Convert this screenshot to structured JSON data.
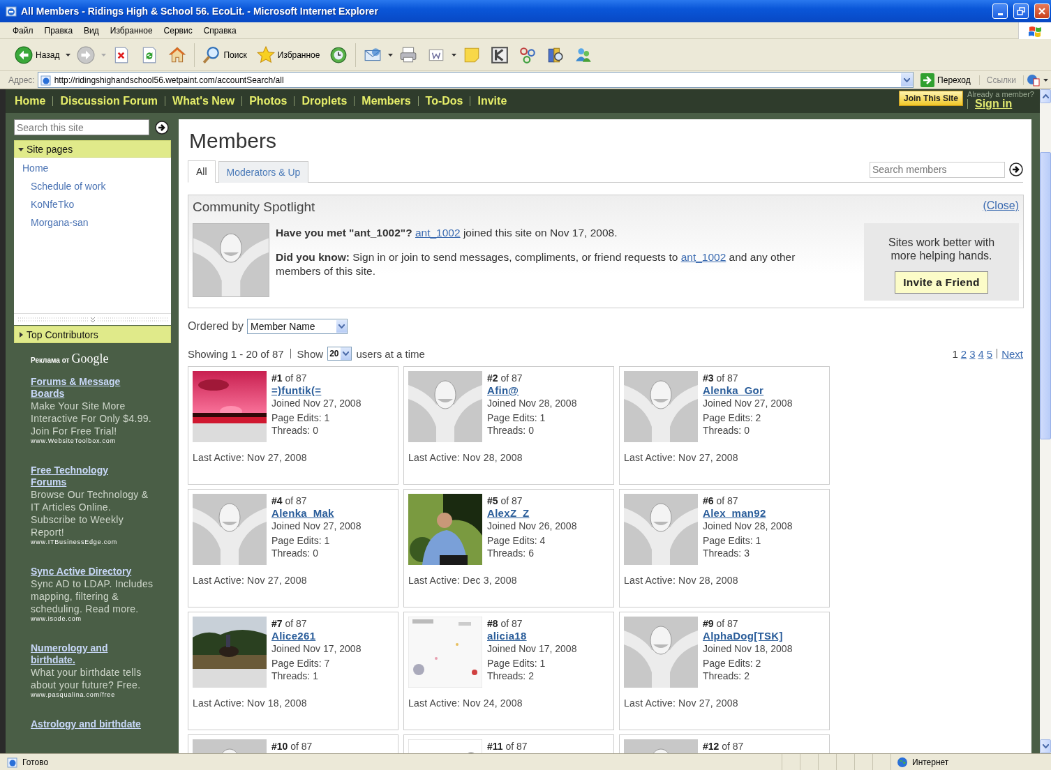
{
  "window": {
    "title": "All Members - Ridings High & School 56. EcoLit. - Microsoft Internet Explorer"
  },
  "menu": [
    "Файл",
    "Правка",
    "Вид",
    "Избранное",
    "Сервис",
    "Справка"
  ],
  "toolbar": [
    {
      "kind": "back",
      "label": "Назад",
      "dropdown": true
    },
    {
      "kind": "forward",
      "dropdown": true
    },
    {
      "kind": "stop"
    },
    {
      "kind": "refresh"
    },
    {
      "kind": "home"
    },
    {
      "kind": "search",
      "label": "Поиск"
    },
    {
      "kind": "favorites",
      "label": "Избранное"
    },
    {
      "kind": "history"
    },
    {
      "kind": "mail",
      "dropdown": true
    },
    {
      "kind": "print"
    },
    {
      "kind": "edit",
      "dropdown": true
    },
    {
      "kind": "note"
    },
    {
      "kind": "tile"
    },
    {
      "kind": "nodes"
    },
    {
      "kind": "book"
    },
    {
      "kind": "people"
    }
  ],
  "address": {
    "label": "Адрес:",
    "url": "http://ridingshighandschool56.wetpaint.com/accountSearch/all",
    "go": "Переход",
    "links": "Ссылки"
  },
  "site": {
    "nav": [
      "Home",
      "Discussion Forum",
      "What's New",
      "Photos",
      "Droplets",
      "Members",
      "To-Dos",
      "Invite"
    ],
    "join": "Join This Site",
    "member_prompt": "Already a member?",
    "sign_in": "Sign in"
  },
  "sidebar": {
    "search": {
      "placeholder": "Search this site"
    },
    "sections": [
      {
        "title": "Site pages",
        "expanded": true,
        "pages": [
          {
            "label": "Home",
            "children": [
              {
                "label": "Schedule of work"
              },
              {
                "label": "KoNfeTko"
              },
              {
                "label": "Morgana-san"
              }
            ]
          }
        ]
      },
      {
        "title": "Top Contributors",
        "expanded": false
      }
    ],
    "ads_label": "Реклама от",
    "ads_brand": "Google",
    "ads": [
      {
        "title": "Forums & Message Boards",
        "text": "Make Your Site More Interactive For Only $4.99. Join For Free Trial!",
        "url": "www.WebsiteToolbox.com"
      },
      {
        "title": "Free Technology Forums",
        "text": "Browse Our Technology & IT Articles Online. Subscribe to Weekly Report!",
        "url": "www.ITBusinessEdge.com"
      },
      {
        "title": "Sync Active Directory",
        "text": "Sync AD to LDAP. Includes mapping, filtering & scheduling. Read more.",
        "url": "www.isode.com"
      },
      {
        "title": "Numerology and birthdate.",
        "text": "What your birthdate tells about your future? Free.",
        "url": "www.pasqualina.com/free"
      },
      {
        "title": "Astrology and birthdate"
      }
    ]
  },
  "main": {
    "title": "Members",
    "tabs": [
      {
        "label": "All",
        "selected": true
      },
      {
        "label": "Moderators & Up",
        "selected": false
      }
    ],
    "search": {
      "placeholder": "Search members"
    },
    "spotlight": {
      "title": "Community Spotlight",
      "close": "(Close)",
      "paragraphs": [
        {
          "lead": "Have you met \"ant_1002\"?",
          "link": "ant_1002",
          "after": "joined this site on Nov 17, 2008."
        },
        {
          "lead": "Did you know:",
          "text": "Sign in or join to send messages, compliments, or friend requests to",
          "link": "ant_1002",
          "after": "and any other members of this site."
        }
      ],
      "pitch": "Sites work better with more helping hands.",
      "invite": "Invite a Friend"
    },
    "order": {
      "label": "Ordered by",
      "value": "Member Name"
    },
    "showing": {
      "text": "Showing 1 - 20 of 87",
      "show": "Show",
      "per_page": "20",
      "suffix": "users at a time"
    },
    "pages": [
      {
        "label": "1",
        "selected": true
      },
      {
        "label": "2",
        "selected": false
      },
      {
        "label": "3",
        "selected": false
      },
      {
        "label": "4",
        "selected": false
      },
      {
        "label": "5",
        "selected": false
      }
    ],
    "next": "Next",
    "members": [
      {
        "rank": "**#1** of 87",
        "name": "=)funtik(=",
        "joined": "Joined Nov 27, 2008",
        "edits": "Page Edits: 1",
        "threads": "Threads: 0",
        "last_active": "Last Active: Nov 27, 2008",
        "kind": "picture"
      },
      {
        "rank": "**#2** of 87",
        "name": "Afin@",
        "joined": "Joined Nov 28, 2008",
        "edits": "Page Edits: 1",
        "threads": "Threads: 0",
        "last_active": "Last Active: Nov 28, 2008",
        "kind": "default"
      },
      {
        "rank": "**#3** of 87",
        "name": "Alenka_Gor",
        "joined": "Joined Nov 27, 2008",
        "edits": "Page Edits: 2",
        "threads": "Threads: 0",
        "last_active": "Last Active: Nov 27, 2008",
        "kind": "default"
      },
      {
        "rank": "**#4** of 87",
        "name": "Alenka_Mak",
        "joined": "Joined Nov 27, 2008",
        "edits": "Page Edits: 1",
        "threads": "Threads: 0",
        "last_active": "Last Active: Nov 27, 2008",
        "kind": "default"
      },
      {
        "rank": "**#5** of 87",
        "name": "AlexZ_Z",
        "joined": "Joined Nov 26, 2008",
        "edits": "Page Edits: 4",
        "threads": "Threads: 6",
        "last_active": "Last Active: Dec 3, 2008",
        "kind": "picture"
      },
      {
        "rank": "**#6** of 87",
        "name": "Alex_man92",
        "joined": "Joined Nov 28, 2008",
        "edits": "Page Edits: 1",
        "threads": "Threads: 3",
        "last_active": "Last Active: Nov 28, 2008",
        "kind": "default"
      },
      {
        "rank": "**#7** of 87",
        "name": "Alice261",
        "joined": "Joined Nov 17, 2008",
        "edits": "Page Edits: 7",
        "threads": "Threads: 1",
        "last_active": "Last Active: Nov 18, 2008",
        "kind": "picture"
      },
      {
        "rank": "**#8** of 87",
        "name": "alicia18",
        "joined": "Joined Nov 17, 2008",
        "edits": "Page Edits: 1",
        "threads": "Threads: 2",
        "last_active": "Last Active: Nov 24, 2008",
        "kind": "picture"
      },
      {
        "rank": "**#9** of 87",
        "name": "AlphaDog[TSK]",
        "joined": "Joined Nov 18, 2008",
        "edits": "Page Edits: 2",
        "threads": "Threads: 2",
        "last_active": "Last Active: Nov 27, 2008",
        "kind": "default"
      },
      {
        "rank": "**#10** of 87",
        "kind": "default"
      },
      {
        "rank": "**#11** of 87",
        "kind": "picture"
      },
      {
        "rank": "**#12** of 87",
        "kind": "default"
      }
    ]
  },
  "status": {
    "text": "Готово",
    "zone": "Интернет"
  }
}
